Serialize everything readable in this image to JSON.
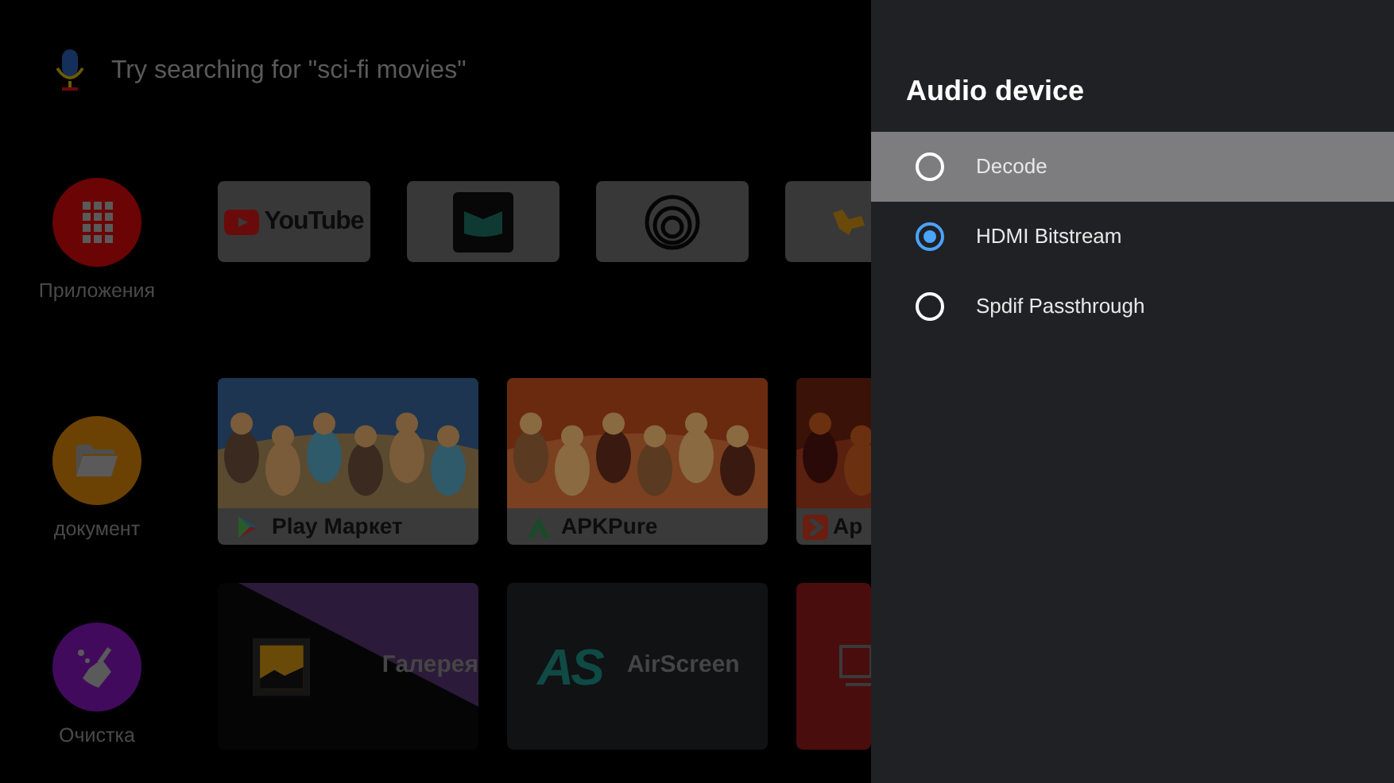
{
  "search": {
    "placeholder": "Try searching for \"sci-fi movies\""
  },
  "sections": [
    {
      "rail": {
        "kind": "apps",
        "label": "Приложения",
        "color": "#6b0404"
      },
      "tiles": [
        {
          "kind": "youtube",
          "label": "YouTube"
        },
        {
          "kind": "green-m"
        },
        {
          "kind": "rings"
        },
        {
          "kind": "partial"
        }
      ]
    },
    {
      "rail": {
        "kind": "folder",
        "label": "документ",
        "color": "#6b4204"
      },
      "tiles": [
        {
          "kind": "picture-card",
          "label": "Play Маркет"
        },
        {
          "kind": "picture-card",
          "label": "APKPure"
        },
        {
          "kind": "picture-card",
          "label": "Ap"
        }
      ]
    },
    {
      "rail": {
        "kind": "cleaner",
        "label": "Очистка",
        "color": "#420a5c"
      },
      "tiles": [
        {
          "kind": "gallery",
          "label": "Галерея"
        },
        {
          "kind": "airscreen",
          "logo": "AS",
          "label": "AirScreen"
        },
        {
          "kind": "cast"
        }
      ]
    }
  ],
  "dialog": {
    "title": "Audio device",
    "options": [
      {
        "label": "Decode",
        "selected": false,
        "focused": true
      },
      {
        "label": "HDMI Bitstream",
        "selected": true,
        "focused": false
      },
      {
        "label": "Spdif Passthrough",
        "selected": false,
        "focused": false
      }
    ]
  }
}
